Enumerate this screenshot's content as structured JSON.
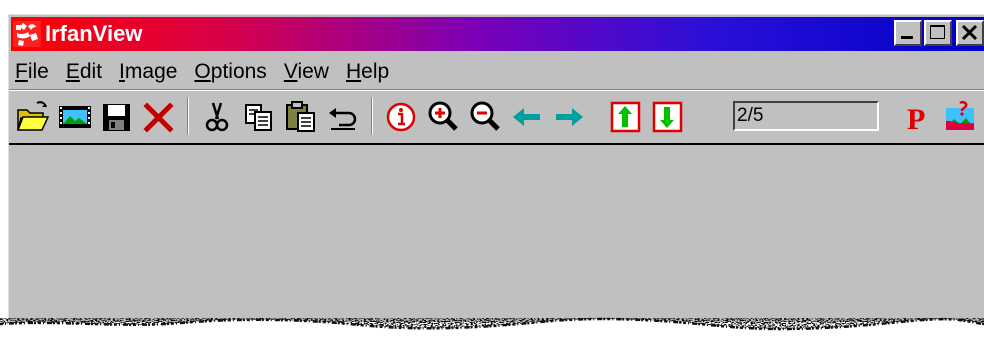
{
  "window": {
    "title": "IrfanView",
    "controls": {
      "minimize_icon": "minimize-icon",
      "maximize_icon": "maximize-icon",
      "close_icon": "close-icon"
    }
  },
  "menu": {
    "items": [
      {
        "id": "file",
        "underline": "F",
        "rest": "ile"
      },
      {
        "id": "edit",
        "underline": "E",
        "rest": "dit"
      },
      {
        "id": "image",
        "underline": "I",
        "rest": "mage"
      },
      {
        "id": "options",
        "underline": "O",
        "rest": "ptions"
      },
      {
        "id": "view",
        "underline": "V",
        "rest": "iew"
      },
      {
        "id": "help",
        "underline": "H",
        "rest": "elp"
      }
    ]
  },
  "toolbar": {
    "icons": [
      "open-folder-icon",
      "slideshow-icon",
      "save-icon",
      "delete-icon",
      "cut-icon",
      "copy-icon",
      "paste-icon",
      "undo-icon",
      "info-icon",
      "zoom-in-icon",
      "zoom-out-icon",
      "previous-icon",
      "next-icon",
      "first-page-icon",
      "last-page-icon",
      "print-icon",
      "about-icon"
    ],
    "page_indicator": "2/5",
    "print_label": "P"
  },
  "colors": {
    "window_bg": "#c0c0c0",
    "title_gradient_start": "#ff0000",
    "title_gradient_end": "#0000c8",
    "title_text": "#ffffff",
    "accent_red": "#e00000",
    "accent_teal": "#00a0a0",
    "accent_green": "#00c000"
  }
}
